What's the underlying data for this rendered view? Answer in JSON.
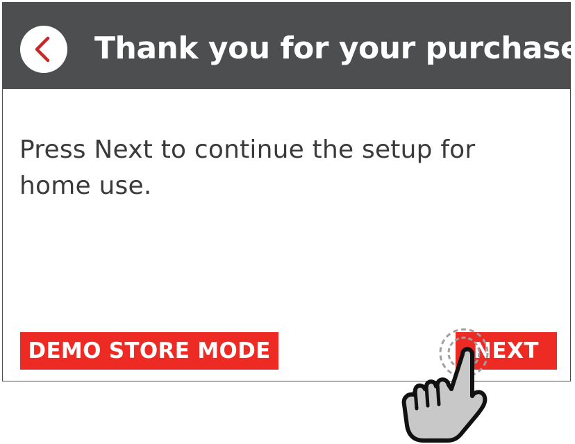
{
  "header": {
    "title": "Thank you for your purchase!",
    "back_icon": "chevron-left-icon"
  },
  "body": {
    "message": "Press Next to continue the setup for home use."
  },
  "footer": {
    "demo_button_label": "DEMO STORE MODE",
    "next_button_label": "NEXT"
  },
  "overlay": {
    "gesture_icon": "tap-hand-icon"
  },
  "colors": {
    "header_bg": "#4c4e50",
    "accent": "#ed2a24",
    "back_chevron": "#c8282a",
    "text": "#3a3a3a",
    "hand_fill": "#c8c8c8"
  }
}
